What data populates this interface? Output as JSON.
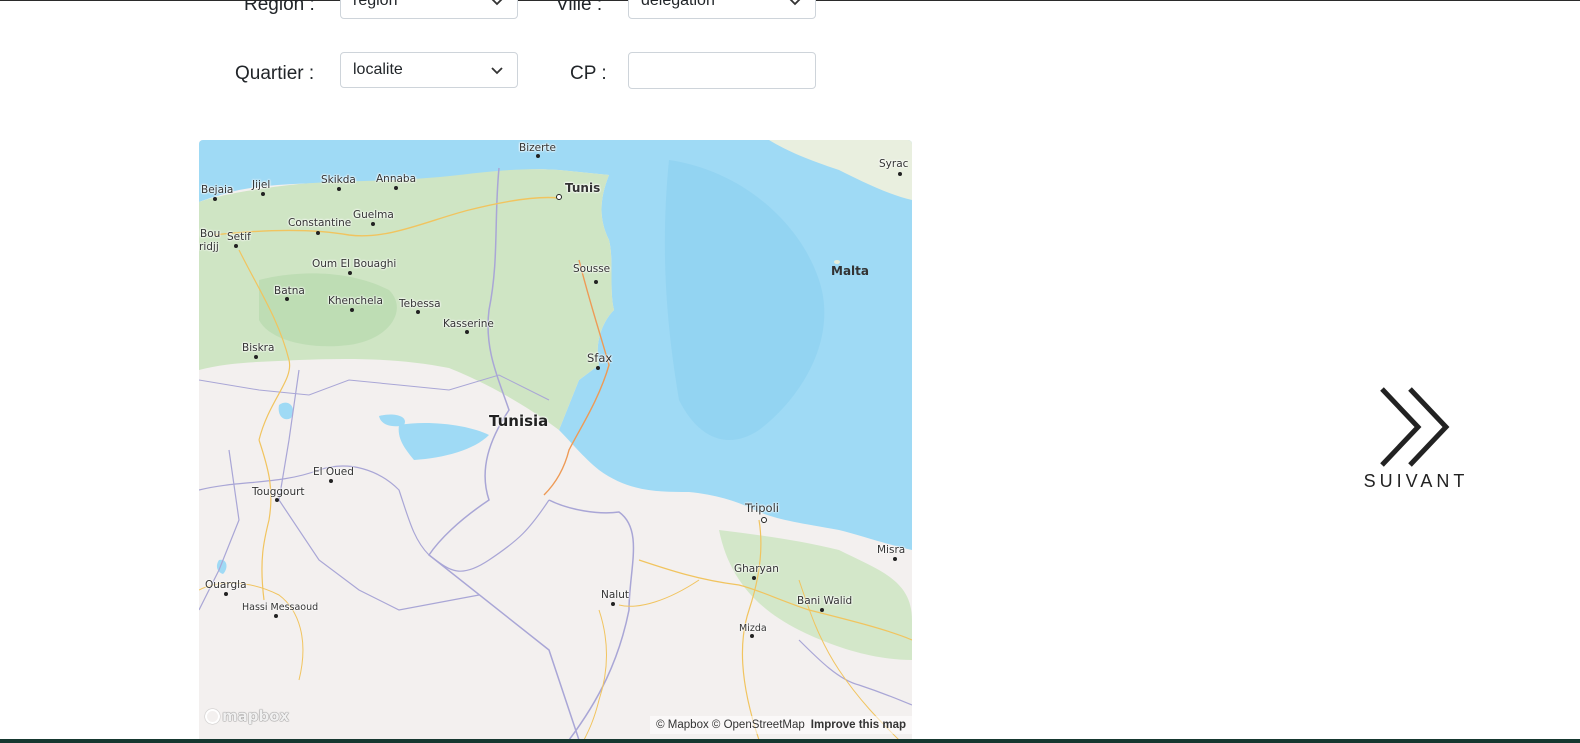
{
  "form": {
    "region": {
      "label": "Region :",
      "value": "region"
    },
    "ville": {
      "label": "Ville :",
      "value": "delegation"
    },
    "quartier": {
      "label": "Quartier :",
      "value": "localite"
    },
    "cp": {
      "label": "CP :",
      "value": ""
    }
  },
  "map": {
    "country_label": "Tunisia",
    "sea_label": "Malta",
    "cities": [
      "Bizerte",
      "Tunis",
      "Bejaia",
      "Jijel",
      "Skikda",
      "Annaba",
      "Constantine",
      "Guelma",
      "Bou",
      "ridjj",
      "Setif",
      "Oum El Bouaghi",
      "Sousse",
      "Batna",
      "Khenchela",
      "Tebessa",
      "Kasserine",
      "Biskra",
      "Sfax",
      "El Oued",
      "Touggourt",
      "Tripoli",
      "Misra",
      "Gharyan",
      "Ouargla",
      "Hassi Messaoud",
      "Nalut",
      "Bani Walid",
      "Mizda",
      "Syrac"
    ],
    "logo": "mapbox",
    "attribution": "© Mapbox © OpenStreetMap",
    "improve_link": "Improve this map",
    "colors": {
      "sea": "#9fdaf5",
      "land_green": "#cfe5c4",
      "desert": "#f3f0ef",
      "border": "#a9a6d6",
      "road": "#f1c45f"
    }
  },
  "next_button": {
    "label": "SUIVANT",
    "icon": "double-chevron-right-icon"
  }
}
